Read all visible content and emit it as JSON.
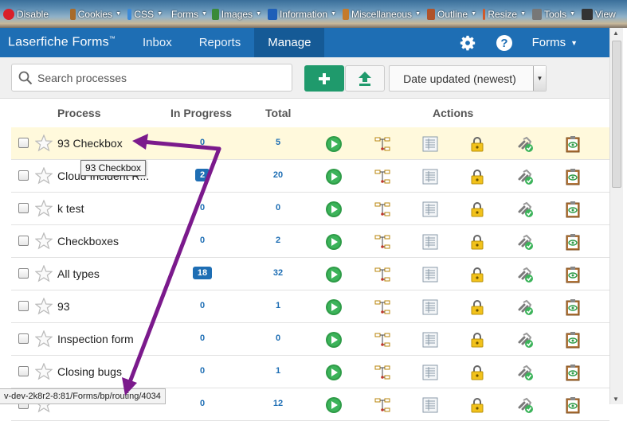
{
  "devbar": {
    "items": [
      {
        "label": "Disable",
        "icon": "disable-icon"
      },
      {
        "label": "Cookies",
        "icon": "cookie-icon"
      },
      {
        "label": "CSS",
        "icon": "css-icon"
      },
      {
        "label": "Forms",
        "icon": "forms-icon"
      },
      {
        "label": "Images",
        "icon": "image-icon"
      },
      {
        "label": "Information",
        "icon": "info-icon"
      },
      {
        "label": "Miscellaneous",
        "icon": "misc-icon"
      },
      {
        "label": "Outline",
        "icon": "outline-icon"
      },
      {
        "label": "Resize",
        "icon": "resize-icon"
      },
      {
        "label": "Tools",
        "icon": "tools-icon"
      },
      {
        "label": "View",
        "icon": "view-icon"
      }
    ]
  },
  "nav": {
    "brand": "Laserfiche Forms",
    "trademark": "™",
    "items": [
      "Inbox",
      "Reports",
      "Manage"
    ],
    "active": "Manage",
    "forms_menu": "Forms"
  },
  "toolbar": {
    "search_placeholder": "Search processes",
    "sort_label": "Date updated (newest)"
  },
  "table": {
    "headers": {
      "process": "Process",
      "in_progress": "In Progress",
      "total": "Total",
      "actions": "Actions"
    },
    "rows": [
      {
        "name": "93 Checkbox",
        "in_progress": "0",
        "total": "5",
        "badge": false,
        "highlight": true
      },
      {
        "name": "Cloud Incident R...",
        "in_progress": "2",
        "total": "20",
        "badge": true,
        "highlight": false
      },
      {
        "name": "k test",
        "in_progress": "0",
        "total": "0",
        "badge": false,
        "highlight": false
      },
      {
        "name": "Checkboxes",
        "in_progress": "0",
        "total": "2",
        "badge": false,
        "highlight": false
      },
      {
        "name": "All types",
        "in_progress": "18",
        "total": "32",
        "badge": true,
        "highlight": false
      },
      {
        "name": "93",
        "in_progress": "0",
        "total": "1",
        "badge": false,
        "highlight": false
      },
      {
        "name": "Inspection form",
        "in_progress": "0",
        "total": "0",
        "badge": false,
        "highlight": false
      },
      {
        "name": "Closing bugs",
        "in_progress": "0",
        "total": "1",
        "badge": false,
        "highlight": false
      },
      {
        "name": "",
        "in_progress": "0",
        "total": "12",
        "badge": false,
        "highlight": false
      }
    ]
  },
  "tooltip": "93 Checkbox",
  "status_url": "v-dev-2k8r2-8:81/Forms/bp/routing/4034",
  "colors": {
    "nav": "#1e6eb4",
    "accent_green": "#1f9a6c",
    "annotation_arrow": "#7b1a8c"
  }
}
